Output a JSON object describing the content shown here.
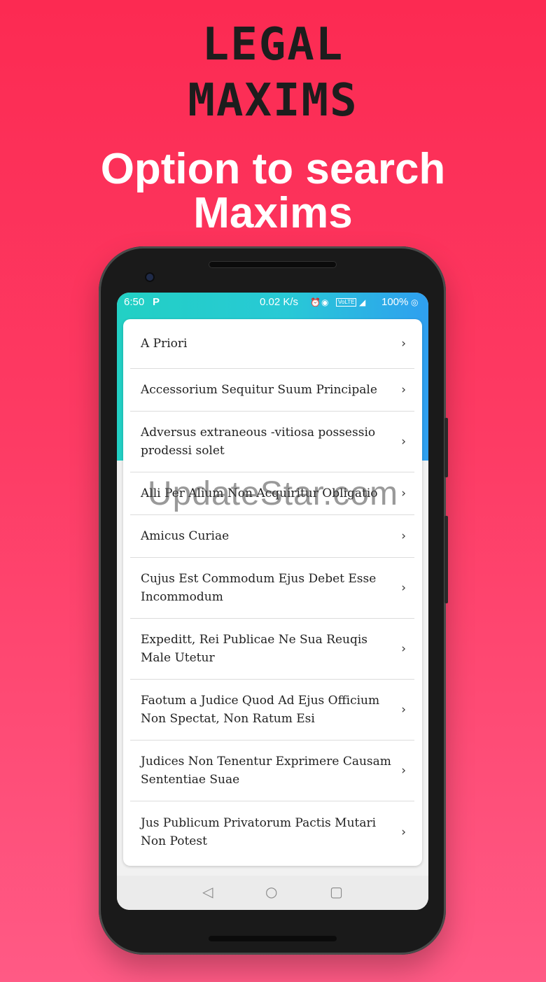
{
  "promo": {
    "title_line1": "LEGAL",
    "title_line2": "MAXIMS",
    "subtitle_line1": "Option to search",
    "subtitle_line2": "Maxims"
  },
  "status_bar": {
    "time": "6:50",
    "app_icon": "P",
    "net_speed": "0.02 K/s",
    "alarm_icon": "alarm-icon",
    "hotspot_icon": "hotspot-icon",
    "volte": "VoLTE",
    "signal_icon": "signal-icon",
    "battery": "100%",
    "battery_icon": "battery-ring-icon"
  },
  "list": {
    "items": [
      {
        "label": "A Priori"
      },
      {
        "label": "Accessorium Sequitur Suum Principale"
      },
      {
        "label": "Adversus extraneous -vitiosa possessio prodessi solet"
      },
      {
        "label": "Alli Per Alium Non Acquiritur Obligatio"
      },
      {
        "label": "Amicus Curiae"
      },
      {
        "label": "Cujus Est Commodum Ejus Debet Esse Incommodum"
      },
      {
        "label": "Expeditt, Rei Publicae Ne Sua Reuqis Male Utetur"
      },
      {
        "label": "Faotum a Judice Quod Ad Ejus Officium Non Spectat, Non Ratum Esi"
      },
      {
        "label": "Judices Non Tenentur Exprimere Causam Sententiae Suae"
      },
      {
        "label": "Jus Publicum Privatorum Pactis Mutari Non Potest"
      }
    ],
    "chevron": "›"
  },
  "nav": {
    "back": "◁",
    "home": "○",
    "recent": "▢"
  },
  "watermark": "UpdateStar.com",
  "colors": {
    "background_top": "#fc2a52",
    "background_bottom": "#ff5a85",
    "header_teal": "#22d0c4",
    "header_blue": "#2f9ff0"
  }
}
